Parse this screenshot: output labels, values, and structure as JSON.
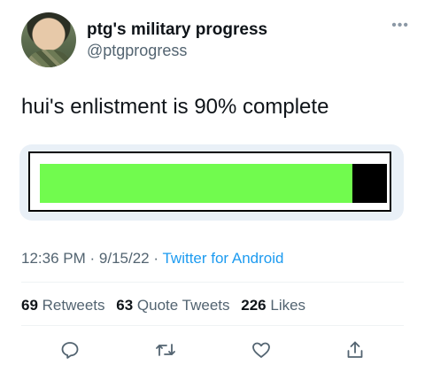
{
  "user": {
    "display_name": "ptg's military progress",
    "handle": "@ptgprogress",
    "avatar_icon": "profile-photo"
  },
  "more_icon": "ellipsis",
  "tweet": {
    "text": "hui's enlistment is 90% complete"
  },
  "progress": {
    "fraction": 0.9,
    "fill_color": "#71fb4e",
    "empty_color": "#000000"
  },
  "meta": {
    "time": "12:36 PM",
    "separator": "·",
    "date": "9/15/22",
    "source": "Twitter for Android"
  },
  "stats": {
    "retweets_count": "69",
    "retweets_label": "Retweets",
    "quotes_count": "63",
    "quotes_label": "Quote Tweets",
    "likes_count": "226",
    "likes_label": "Likes"
  },
  "actions": [
    {
      "icon": "reply-icon"
    },
    {
      "icon": "retweet-icon"
    },
    {
      "icon": "like-icon"
    },
    {
      "icon": "share-icon"
    }
  ],
  "colors": {
    "text": "#0f1419",
    "secondary": "#536471",
    "link": "#1d9bf0",
    "card_bg": "#e9f0f7"
  }
}
